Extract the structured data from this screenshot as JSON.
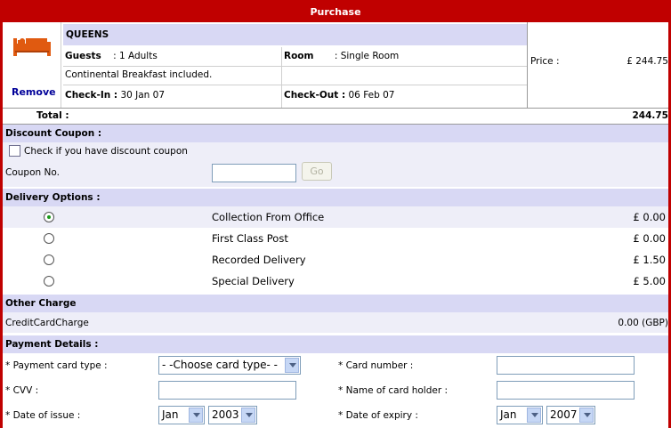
{
  "header": {
    "title": "Purchase"
  },
  "booking": {
    "remove_label": "Remove",
    "hotel_name": "QUEENS",
    "guests_label": "Guests",
    "guests_value": ": 1 Adults",
    "room_label": "Room",
    "room_value": ": Single Room",
    "breakfast_note": "Continental Breakfast included.",
    "checkin_label": "Check-In :",
    "checkin_value": "30 Jan 07",
    "checkout_label": "Check-Out :",
    "checkout_value": "06 Feb 07",
    "price_label": "Price :",
    "price_value": "£ 244.75"
  },
  "total": {
    "label": "Total :",
    "value": "244.75"
  },
  "discount": {
    "section_title": "Discount Coupon :",
    "checkbox_label": "Check if you have discount coupon",
    "checkbox_checked": false,
    "coupon_label": "Coupon No.",
    "coupon_value": "",
    "go_label": "Go"
  },
  "delivery": {
    "section_title": "Delivery Options :",
    "options": [
      {
        "label": "Collection From Office",
        "price": "£ 0.00",
        "selected": true
      },
      {
        "label": "First Class Post",
        "price": "£ 0.00",
        "selected": false
      },
      {
        "label": "Recorded Delivery",
        "price": "£ 1.50",
        "selected": false
      },
      {
        "label": "Special Delivery",
        "price": "£ 5.00",
        "selected": false
      }
    ]
  },
  "other_charge": {
    "section_title": "Other Charge",
    "label": "CreditCardCharge",
    "value": "0.00 (GBP)"
  },
  "payment": {
    "section_title": "Payment Details :",
    "card_type_label": "* Payment card type :",
    "card_type_value": "- -Choose card type- -",
    "card_number_label": "* Card number :",
    "card_number_value": "",
    "cvv_label": "* CVV :",
    "cvv_value": "",
    "holder_label": "* Name of card holder :",
    "holder_value": "",
    "issue_label": "* Date of issue :",
    "issue_month": "Jan",
    "issue_year": "2003",
    "expiry_label": "* Date of expiry :",
    "expiry_month": "Jan",
    "expiry_year": "2007"
  },
  "colors": {
    "accent": "#c00000",
    "section_bg": "#d8d8f4",
    "link": "#000099",
    "radio_dot": "#1a9a1a"
  }
}
